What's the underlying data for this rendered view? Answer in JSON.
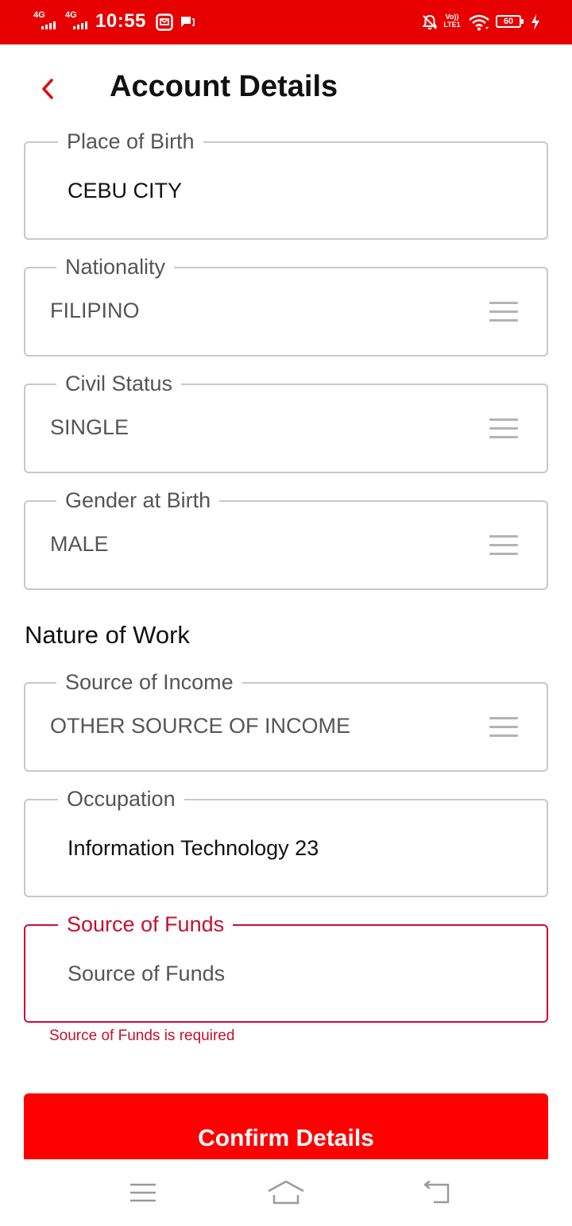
{
  "status_bar": {
    "network_1": "4G",
    "network_2": "4G",
    "time": "10:55",
    "volte_label_1": "Vo))",
    "volte_label_2": "LTE1",
    "battery_level": "60",
    "icons": [
      "signal-icon",
      "message-icon",
      "chat-icon",
      "mute-bell-icon",
      "volte-icon",
      "wifi-icon",
      "battery-icon",
      "charging-icon"
    ]
  },
  "header": {
    "title": "Account Details",
    "back_icon": "chevron-left-icon"
  },
  "fields": {
    "place_of_birth": {
      "label": "Place of Birth",
      "value": "CEBU CITY"
    },
    "nationality": {
      "label": "Nationality",
      "value": "FILIPINO"
    },
    "civil_status": {
      "label": "Civil Status",
      "value": "SINGLE"
    },
    "gender_at_birth": {
      "label": "Gender at Birth",
      "value": "MALE"
    }
  },
  "nature_of_work": {
    "heading": "Nature of Work",
    "source_of_income": {
      "label": "Source of Income",
      "value": "OTHER SOURCE OF INCOME"
    },
    "occupation": {
      "label": "Occupation",
      "value": "Information Technology 23"
    },
    "source_of_funds": {
      "label": "Source of Funds",
      "placeholder": "Source of Funds",
      "error": "Source of Funds is required"
    }
  },
  "actions": {
    "confirm_label": "Confirm Details"
  },
  "nav_bar": {
    "icons": [
      "menu-icon",
      "home-icon",
      "back-icon"
    ]
  },
  "colors": {
    "brand_red": "#e60000",
    "button_red": "#ff0000",
    "error_red": "#c8102e",
    "border_gray": "#c8c8c8"
  }
}
